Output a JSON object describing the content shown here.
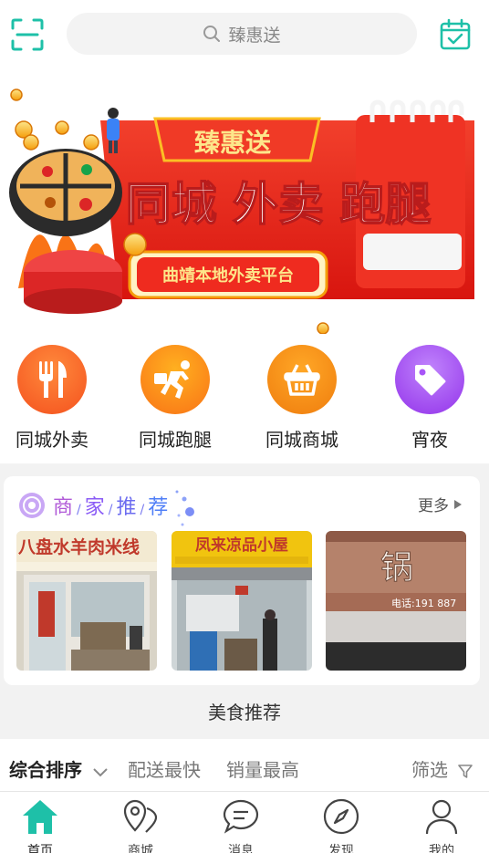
{
  "colors": {
    "accent": "#1ec0a8",
    "banner_red": "#e8271e",
    "orange": "#f97316",
    "purple": "#a855f7"
  },
  "header": {
    "search_placeholder": "臻惠送",
    "scan_icon": "scan-icon",
    "calendar_icon": "calendar-check-icon"
  },
  "banner": {
    "brand": "臻惠送",
    "headline": "同城 外卖 跑腿",
    "subline": "曲靖本地外卖平台"
  },
  "quick": [
    {
      "label": "同城外卖",
      "icon": "fork-knife-icon",
      "color": "#f76b1c"
    },
    {
      "label": "同城跑腿",
      "icon": "runner-icon",
      "color": "#f97316"
    },
    {
      "label": "同城商城",
      "icon": "basket-icon",
      "color": "#f28a1a"
    },
    {
      "label": "宵夜",
      "icon": "tag-icon",
      "color": "#a855f7"
    }
  ],
  "recommend": {
    "title": [
      "商",
      "家",
      "推",
      "荐"
    ],
    "more": "更多",
    "shops": [
      {
        "sign": "八盘水羊肉米线"
      },
      {
        "sign": "凤来凉品小屋"
      },
      {
        "sign": "锅",
        "phone": "电话:191 887"
      }
    ]
  },
  "food_title": "美食推荐",
  "sort": {
    "items": [
      "综合排序",
      "配送最快",
      "销量最高"
    ],
    "filter": "筛选"
  },
  "tabbar": [
    {
      "label": "首页",
      "icon": "home-icon"
    },
    {
      "label": "商城",
      "icon": "map-pin-icon"
    },
    {
      "label": "消息",
      "icon": "chat-icon"
    },
    {
      "label": "发现",
      "icon": "compass-icon"
    },
    {
      "label": "我的",
      "icon": "user-icon"
    }
  ]
}
